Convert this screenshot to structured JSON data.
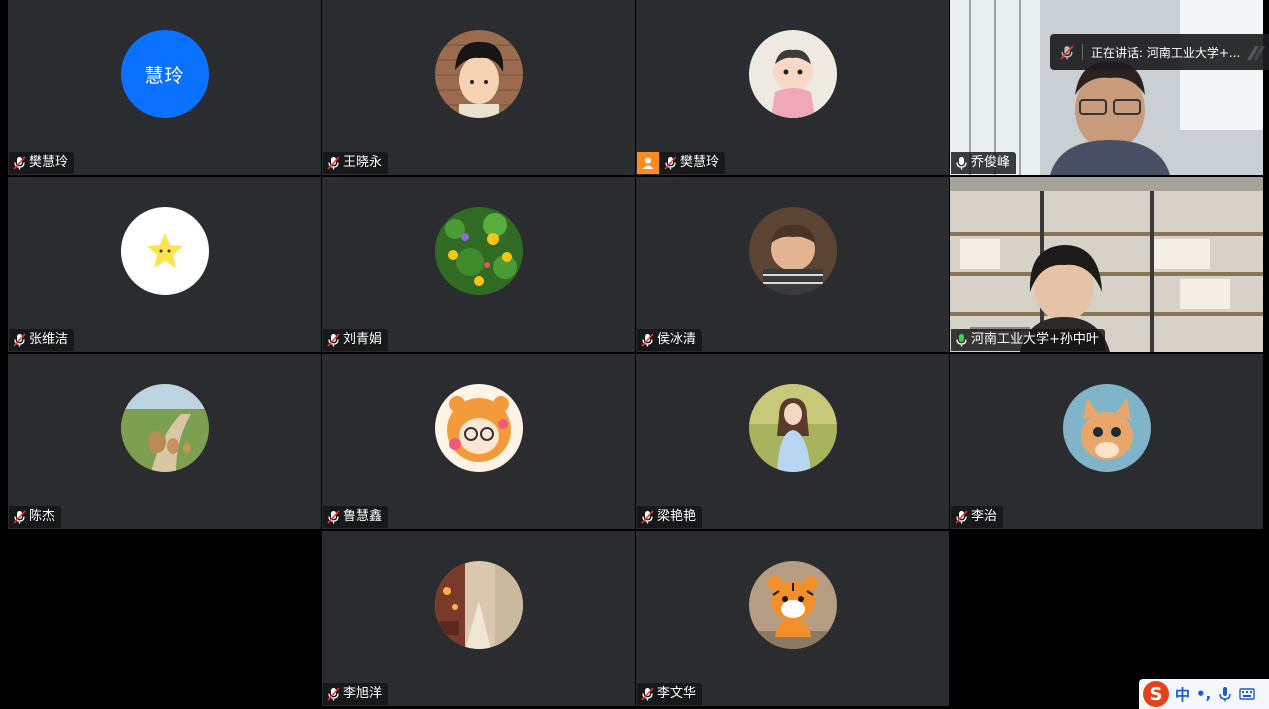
{
  "meeting": {
    "speaking_banner": "正在讲话: 河南工业大学+...",
    "tiles": [
      {
        "name": "樊慧玲",
        "avatar": "initials",
        "initials": "慧玲",
        "host": false
      },
      {
        "name": "王晓永",
        "avatar": "cartoon-boy-avatar",
        "host": false
      },
      {
        "name": "樊慧玲",
        "avatar": "baby-drawing-avatar",
        "host": true
      },
      {
        "name": "乔俊峰",
        "avatar": "camera-video",
        "host": false
      },
      {
        "name": "张维洁",
        "avatar": "star-avatar",
        "host": false
      },
      {
        "name": "刘青娟",
        "avatar": "flowers-avatar",
        "host": false
      },
      {
        "name": "侯冰清",
        "avatar": "child-photo-avatar",
        "host": false
      },
      {
        "name": "河南工业大学+孙中叶",
        "avatar": "camera-video",
        "host": false,
        "active": true
      },
      {
        "name": "陈杰",
        "avatar": "lions-avatar",
        "host": false
      },
      {
        "name": "鲁慧鑫",
        "avatar": "tiger-girl-avatar",
        "host": false
      },
      {
        "name": "梁艳艳",
        "avatar": "woman-photo-avatar",
        "host": false
      },
      {
        "name": "李治",
        "avatar": "kitten-avatar",
        "host": false
      },
      {
        "name": "李旭洋",
        "avatar": "street-avatar",
        "host": false
      },
      {
        "name": "李文华",
        "avatar": "tiger-cub-avatar",
        "host": false
      }
    ]
  },
  "ime": {
    "logo": "S",
    "mode": "中",
    "punct": "•,",
    "icons": [
      "microphone-icon",
      "keyboard-icon"
    ]
  },
  "colors": {
    "tile_bg": "#2a2c30",
    "initials_bg": "#0b72ff",
    "host_badge": "#ff8a1f",
    "active_border": "#3ecf5a"
  }
}
